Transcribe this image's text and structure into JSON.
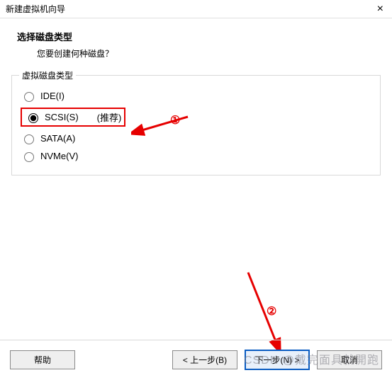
{
  "window": {
    "title": "新建虚拟机向导",
    "close": "×"
  },
  "header": {
    "heading": "选择磁盘类型",
    "sub": "您要创建何种磁盘？"
  },
  "group": {
    "legend": "虚拟磁盘类型",
    "options": {
      "ide": "IDE(I)",
      "scsi": "SCSI(S)",
      "scsi_rec": "(推荐)",
      "sata": "SATA(A)",
      "nvme": "NVMe(V)"
    }
  },
  "buttons": {
    "help": "帮助",
    "back": "< 上一步(B)",
    "next": "下一步(N) >",
    "cancel": "取消"
  },
  "annotations": {
    "one": "①",
    "two": "②"
  },
  "watermark": "CSDN @戴完面具就開跑"
}
